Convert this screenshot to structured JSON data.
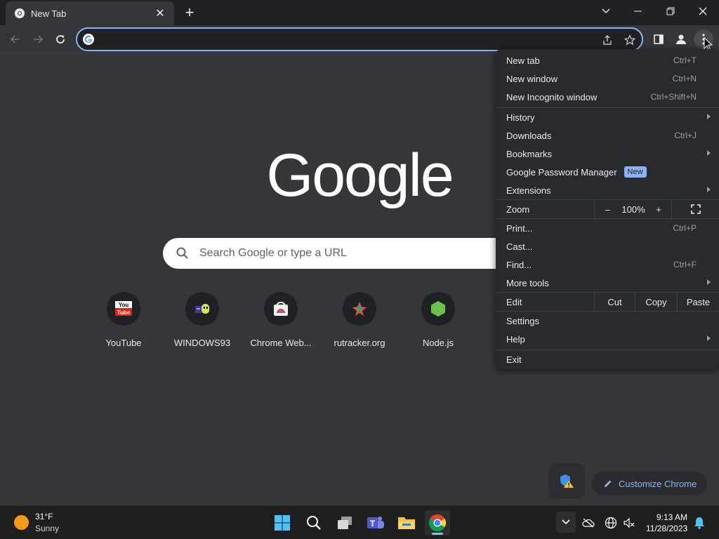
{
  "tab": {
    "title": "New Tab",
    "close_icon": "close-icon"
  },
  "window_controls": [
    "chevron-down-icon",
    "minimize-icon",
    "restore-icon",
    "close-icon"
  ],
  "omnibox": {
    "value": "",
    "placeholder": ""
  },
  "ntp": {
    "logo": "Google",
    "search_placeholder": "Search Google or type a URL",
    "shortcuts": [
      {
        "label": "YouTube",
        "icon": "youtube-icon"
      },
      {
        "label": "WINDOWS93",
        "icon": "windows93-icon"
      },
      {
        "label": "Chrome Web...",
        "icon": "chrome-web-store-icon"
      },
      {
        "label": "rutracker.org",
        "icon": "rutracker-icon"
      },
      {
        "label": "Node.js",
        "icon": "nodejs-icon"
      }
    ],
    "customize_label": "Customize Chrome"
  },
  "menu": {
    "new_tab": {
      "label": "New tab",
      "accel": "Ctrl+T"
    },
    "new_window": {
      "label": "New window",
      "accel": "Ctrl+N"
    },
    "new_incognito": {
      "label": "New Incognito window",
      "accel": "Ctrl+Shift+N"
    },
    "history": {
      "label": "History"
    },
    "downloads": {
      "label": "Downloads",
      "accel": "Ctrl+J"
    },
    "bookmarks": {
      "label": "Bookmarks"
    },
    "password_manager": {
      "label": "Google Password Manager",
      "badge": "New"
    },
    "extensions": {
      "label": "Extensions"
    },
    "zoom": {
      "label": "Zoom",
      "minus": "–",
      "value": "100%",
      "plus": "+"
    },
    "print": {
      "label": "Print...",
      "accel": "Ctrl+P"
    },
    "cast": {
      "label": "Cast..."
    },
    "find": {
      "label": "Find...",
      "accel": "Ctrl+F"
    },
    "more_tools": {
      "label": "More tools"
    },
    "edit": {
      "label": "Edit",
      "cut": "Cut",
      "copy": "Copy",
      "paste": "Paste"
    },
    "settings": {
      "label": "Settings"
    },
    "help": {
      "label": "Help"
    },
    "exit": {
      "label": "Exit"
    }
  },
  "taskbar": {
    "weather": {
      "temp": "31°F",
      "condition": "Sunny"
    },
    "clock": {
      "time": "9:13 AM",
      "date": "11/28/2023"
    }
  },
  "colors": {
    "accent": "#8ab4f8",
    "page_bg": "#35363a",
    "frame_bg": "#202124",
    "menu_bg": "#292a2d"
  }
}
